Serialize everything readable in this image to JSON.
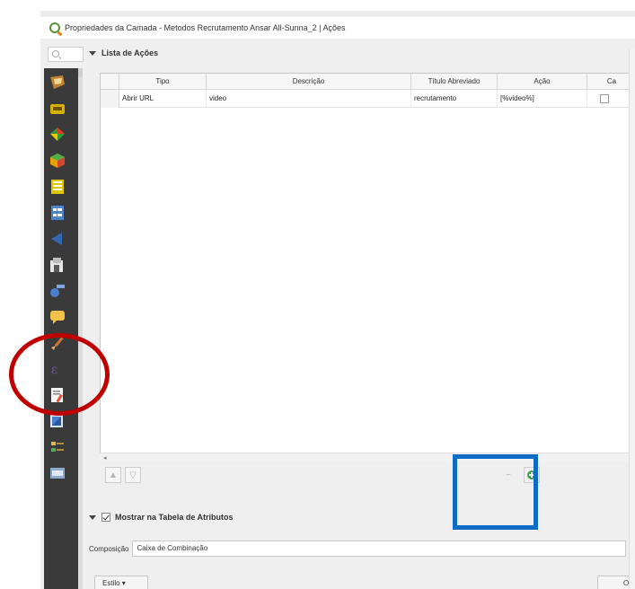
{
  "window": {
    "title": "Propriedades da Camada - Metodos Recrutamento Ansar All-Sunna_2 | Ações"
  },
  "search": {
    "placeholder": ""
  },
  "sidebar": {
    "icons": [
      {
        "name": "information-icon",
        "color": "#c0832e"
      },
      {
        "name": "source-icon",
        "color": "#d4b300"
      },
      {
        "name": "symbology-icon",
        "color": "#e23c20"
      },
      {
        "name": "3d-view-icon",
        "color": "#e6a300"
      },
      {
        "name": "fields-icon",
        "color": "#e0c400"
      },
      {
        "name": "attributes-form-icon",
        "color": "#4b84c8"
      },
      {
        "name": "joins-icon",
        "color": "#3568b3"
      },
      {
        "name": "auxiliary-storage-icon",
        "color": "#c8c8c8"
      },
      {
        "name": "actions-icon",
        "color": "#4a7fd0"
      },
      {
        "name": "display-icon",
        "color": "#f2c24a"
      },
      {
        "name": "rendering-icon",
        "color": "#c9773a"
      },
      {
        "name": "variables-icon",
        "color": "#6b5a96"
      },
      {
        "name": "metadata-icon",
        "color": "#e84d2f"
      },
      {
        "name": "dependencies-icon",
        "color": "#4a7fd0"
      },
      {
        "name": "legend-icon",
        "color": "#b48a3c"
      },
      {
        "name": "qgis-server-icon",
        "color": "#8faacc"
      }
    ]
  },
  "actions_section": {
    "title": "Lista de Ações",
    "columns": [
      "Tipo",
      "Descrição",
      "Título Abreviado",
      "Ação",
      "Ca"
    ],
    "rows": [
      {
        "tipo": "Abrir URL",
        "descricao": "video",
        "titulo": "recrutamento",
        "acao": "[%video%]",
        "capture": false
      }
    ]
  },
  "attribute_table_section": {
    "title": "Mostrar na Tabela de Atributos",
    "checked": true,
    "composition_label": "Composição",
    "composition_value": "Caixa de Combinação"
  },
  "bottom": {
    "style_label": "Estilo",
    "ok_label": "OK"
  },
  "annotations": {
    "red_circle_color": "#c00000",
    "blue_rect_color": "#0f6cc6"
  }
}
